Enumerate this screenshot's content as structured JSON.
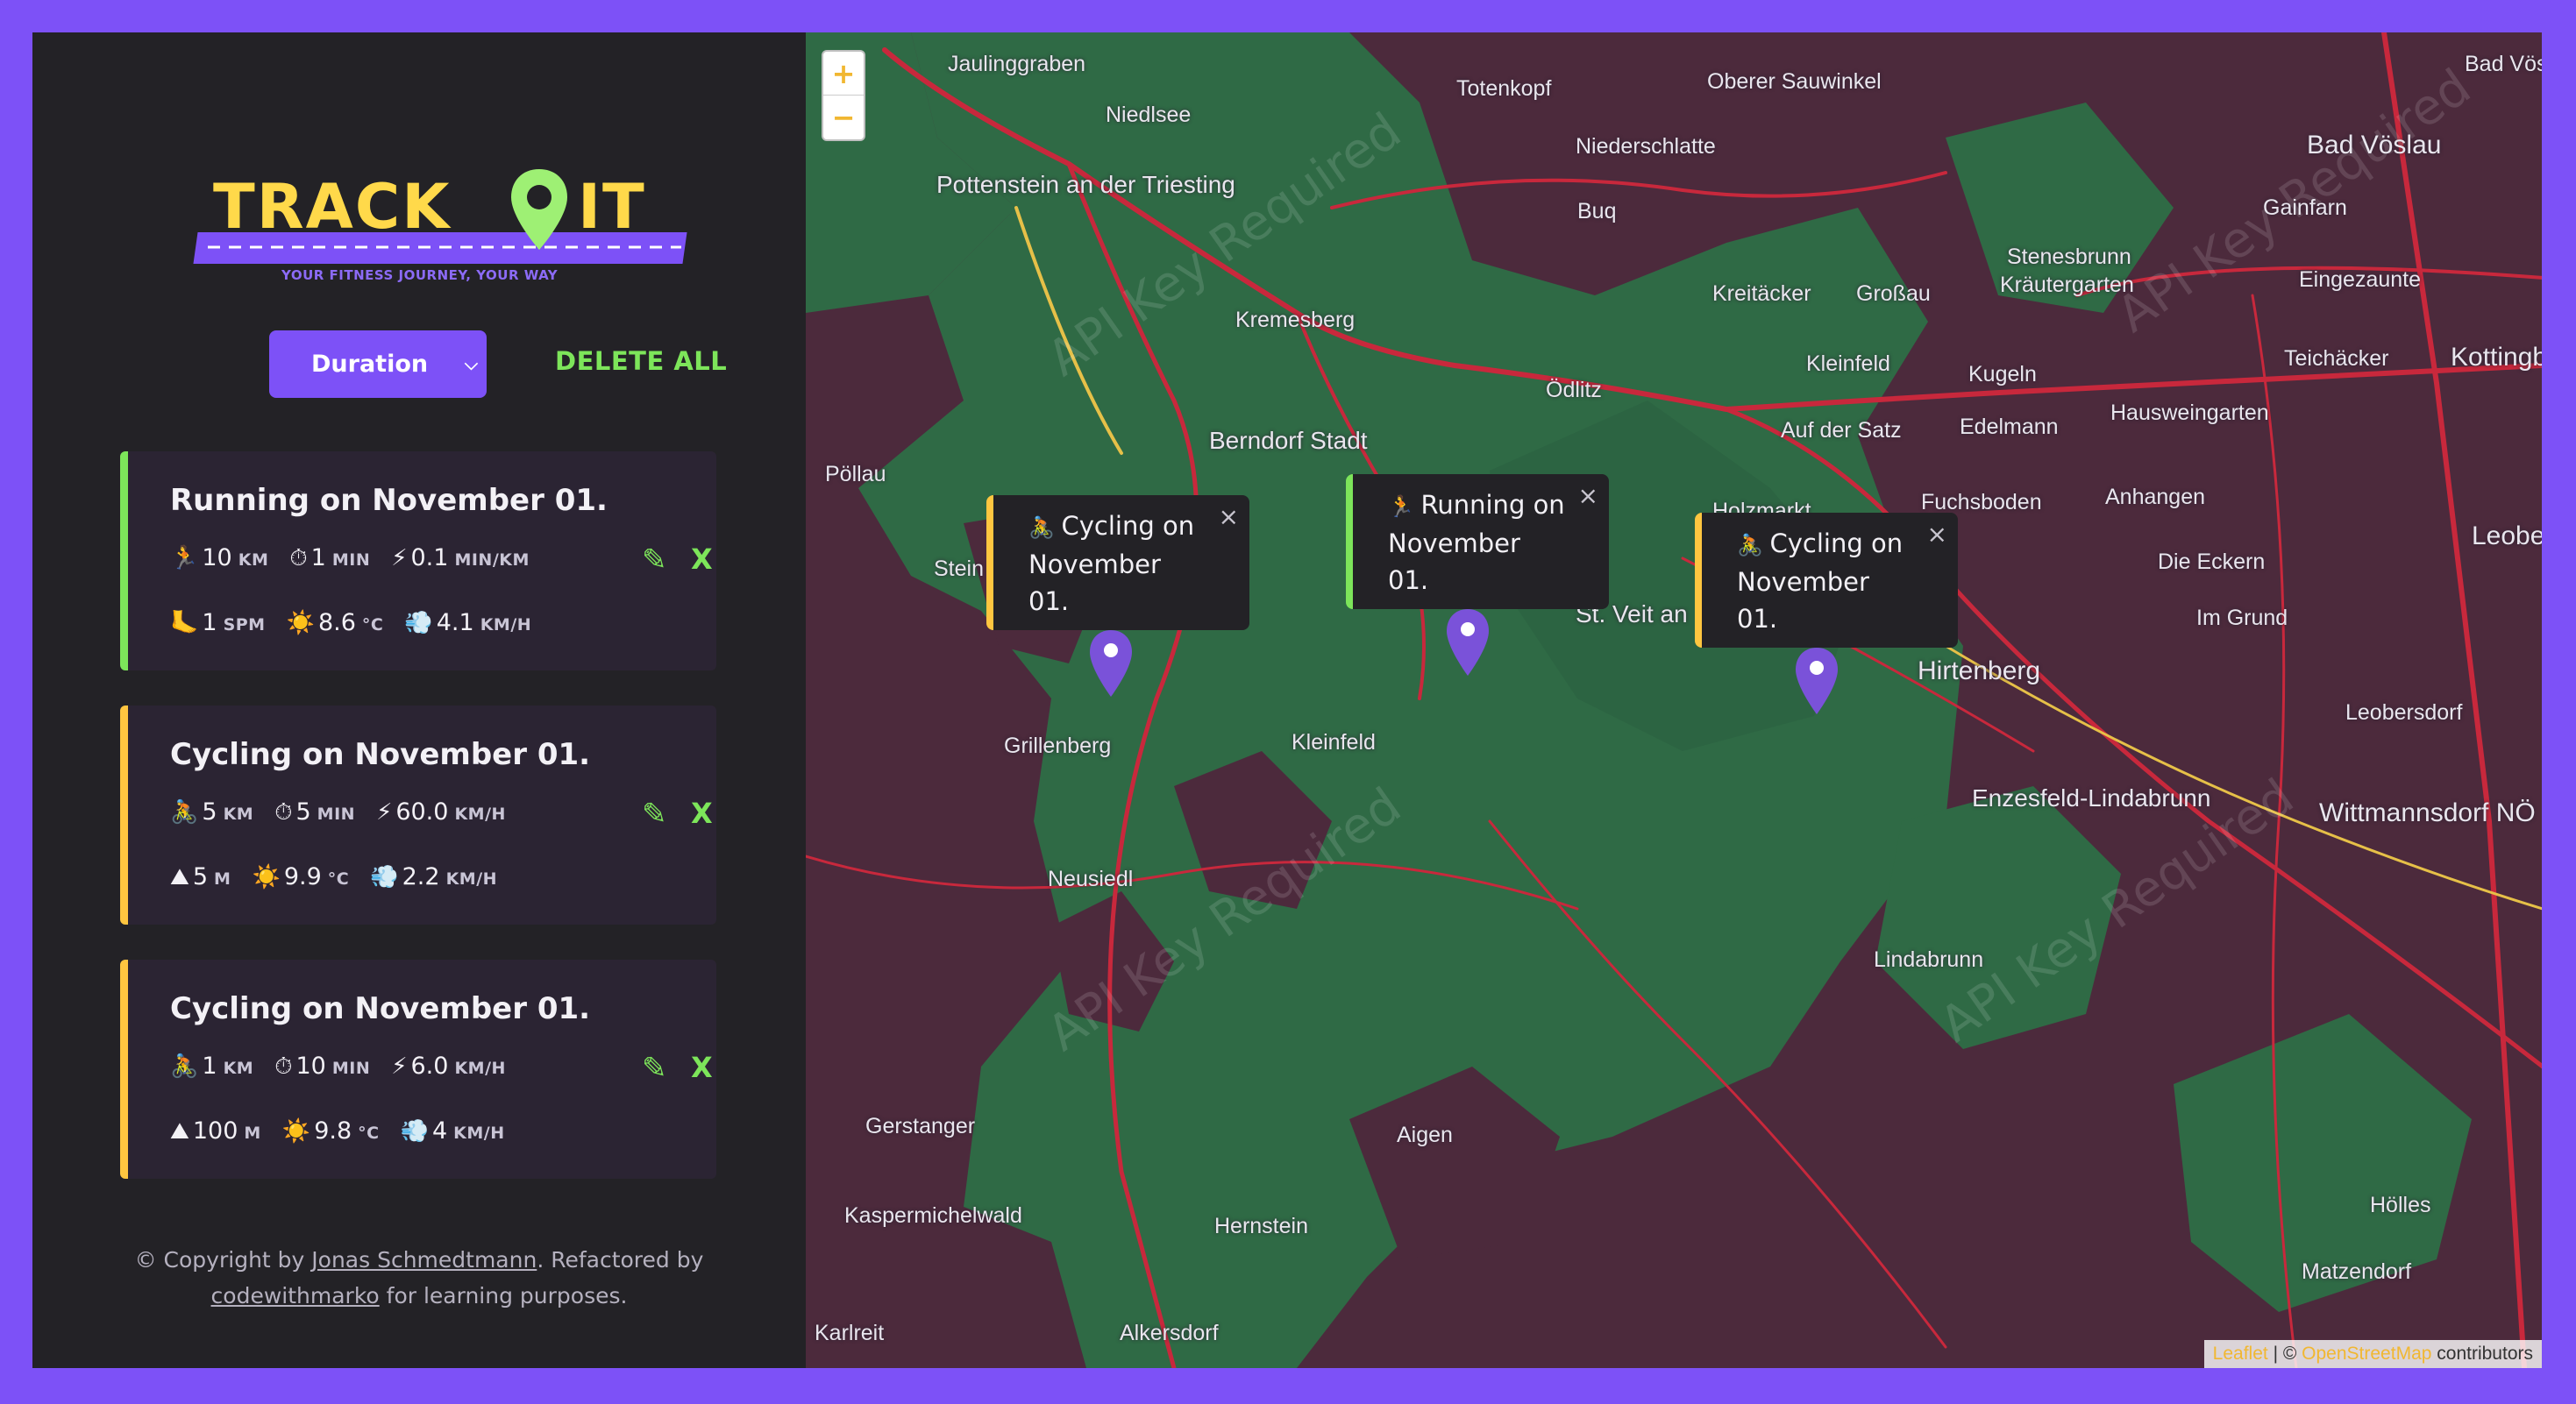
{
  "logo": {
    "word_left": "TRACK",
    "word_right": "IT",
    "tagline": "YOUR FITNESS JOURNEY, YOUR WAY"
  },
  "controls": {
    "sort_value": "Duration",
    "delete_all": "DELETE ALL"
  },
  "workouts": [
    {
      "title": "Running on November 01.",
      "distance": "10",
      "distance_unit": "KM",
      "duration": "1",
      "duration_unit": "MIN",
      "speed": "0.1",
      "speed_unit": "MIN/KM",
      "extra": "1",
      "extra_unit": "SPM",
      "temp": "8.6",
      "temp_unit": "°C",
      "wind": "4.1",
      "wind_unit": "KM/H",
      "delete": "X"
    },
    {
      "title": "Cycling on November 01.",
      "distance": "5",
      "distance_unit": "KM",
      "duration": "5",
      "duration_unit": "MIN",
      "speed": "60.0",
      "speed_unit": "KM/H",
      "extra": "5",
      "extra_unit": "M",
      "temp": "9.9",
      "temp_unit": "°C",
      "wind": "2.2",
      "wind_unit": "KM/H",
      "delete": "X"
    },
    {
      "title": "Cycling on November 01.",
      "distance": "1",
      "distance_unit": "KM",
      "duration": "10",
      "duration_unit": "MIN",
      "speed": "6.0",
      "speed_unit": "KM/H",
      "extra": "100",
      "extra_unit": "M",
      "temp": "9.8",
      "temp_unit": "°C",
      "wind": "4",
      "wind_unit": "KM/H",
      "delete": "X"
    }
  ],
  "footer": {
    "prefix": "© Copyright by",
    "author": "Jonas Schmedtmann",
    "middle": ". Refactored by",
    "refactor": "codewithmarko",
    "suffix": "for learning purposes."
  },
  "map": {
    "zoom_in": "+",
    "zoom_out": "−",
    "places": [
      "Jaulinggraben",
      "Niedlsee",
      "Totenkopf",
      "Oberer Sauwinkel",
      "Bad Vöslau",
      "Pottenstein an der Triesting",
      "Niederschlatte",
      "Buq",
      "Gainfarn",
      "Stenesbrunn",
      "Kräutergarten",
      "Eingezaunte",
      "Kremesberg",
      "Kreitäcker",
      "Großau",
      "Teichäcker",
      "Kottingbru",
      "Kleinfeld",
      "Kugeln",
      "Ödlitz",
      "Hausweingarten",
      "Berndorf Stadt",
      "Auf der Satz",
      "Edelmann",
      "Pöllau",
      "Fuchsboden",
      "Anhangen",
      "Leobe",
      "Stein",
      "Holzmarkt",
      "Die Eckern",
      "St. Veit an",
      "Im Grund",
      "Hirtenberg",
      "Grillenberg",
      "Kleinfeld",
      "Leobersdorf",
      "Enzesfeld-Lindabrunn",
      "Wittmannsdorf NÖ",
      "Neusiedl",
      "Lindabrunn",
      "Gerstanger",
      "Aigen",
      "Kaspermichelwald",
      "Hernstein",
      "Hölles",
      "Matzendorf",
      "Karlreit",
      "Alkersdorf",
      "Bad Vöslau"
    ],
    "watermark": "API Key Required",
    "popups": [
      "Cycling on November 01.",
      "Running on November 01.",
      "Cycling on November 01."
    ],
    "popup_close": "×",
    "attribution": {
      "leaflet": "Leaflet",
      "sep": " | © ",
      "osm": "OpenStreetMap",
      "tail": " contributors"
    }
  },
  "colors": {
    "accent": "#7d51f7",
    "running": "#7de55a",
    "cycling": "#ffc640",
    "logo": "#ffd94a"
  },
  "icons": {
    "running": "runner-icon",
    "cycling": "cyclist-icon",
    "clock": "stopwatch-icon",
    "speed": "lightning-icon",
    "cadence": "footprint-icon",
    "elevation": "mountain-icon",
    "temp": "sun-icon",
    "wind": "wind-icon"
  }
}
